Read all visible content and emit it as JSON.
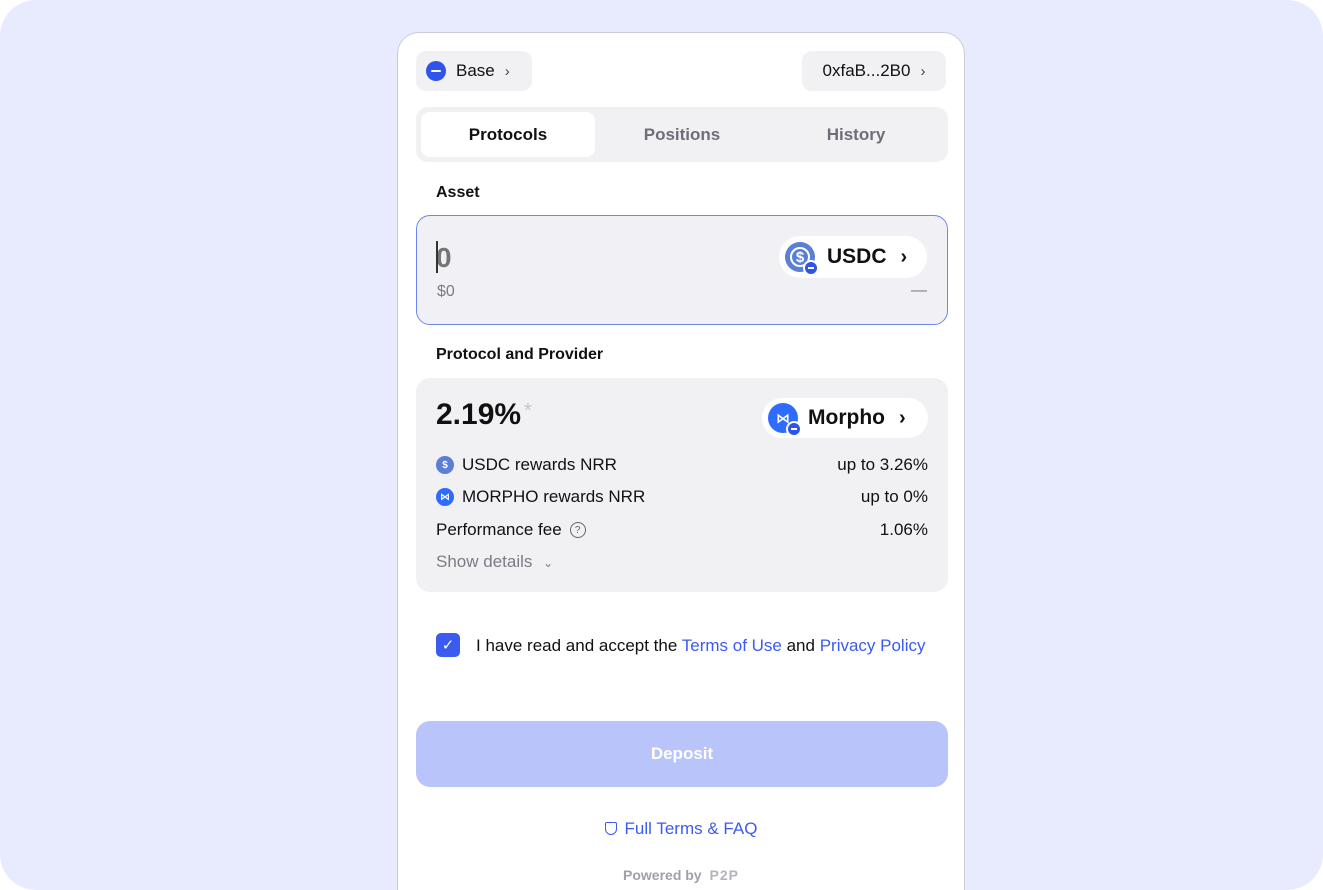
{
  "network": {
    "label": "Base",
    "icon": "base-network-icon"
  },
  "wallet": {
    "address": "0xfaB...2B0"
  },
  "tabs": [
    {
      "label": "Protocols",
      "active": true
    },
    {
      "label": "Positions",
      "active": false
    },
    {
      "label": "History",
      "active": false
    }
  ],
  "asset": {
    "section_label": "Asset",
    "amount": "0",
    "usd_value": "$0",
    "usd_right": "—",
    "token": "USDC"
  },
  "protocol": {
    "section_label": "Protocol and Provider",
    "apy": "2.19%",
    "apy_marker": "*",
    "provider": "Morpho",
    "rows": [
      {
        "label": "USDC rewards NRR",
        "value": "up to 3.26%"
      },
      {
        "label": "MORPHO rewards NRR",
        "value": "up to 0%"
      },
      {
        "label": "Performance fee",
        "value": "1.06%"
      }
    ],
    "show_details": "Show details"
  },
  "terms": {
    "checked": true,
    "prefix": "I have read and accept the ",
    "terms_link": "Terms of Use",
    "middle": " and ",
    "privacy_link": "Privacy Policy"
  },
  "deposit": {
    "label": "Deposit"
  },
  "footer": {
    "faq": "Full Terms & FAQ",
    "powered": "Powered by",
    "brand": "P2P"
  },
  "colors": {
    "accent": "#3b5bf0",
    "background": "#e8ebfd",
    "deposit_disabled": "#b9c4fa"
  }
}
